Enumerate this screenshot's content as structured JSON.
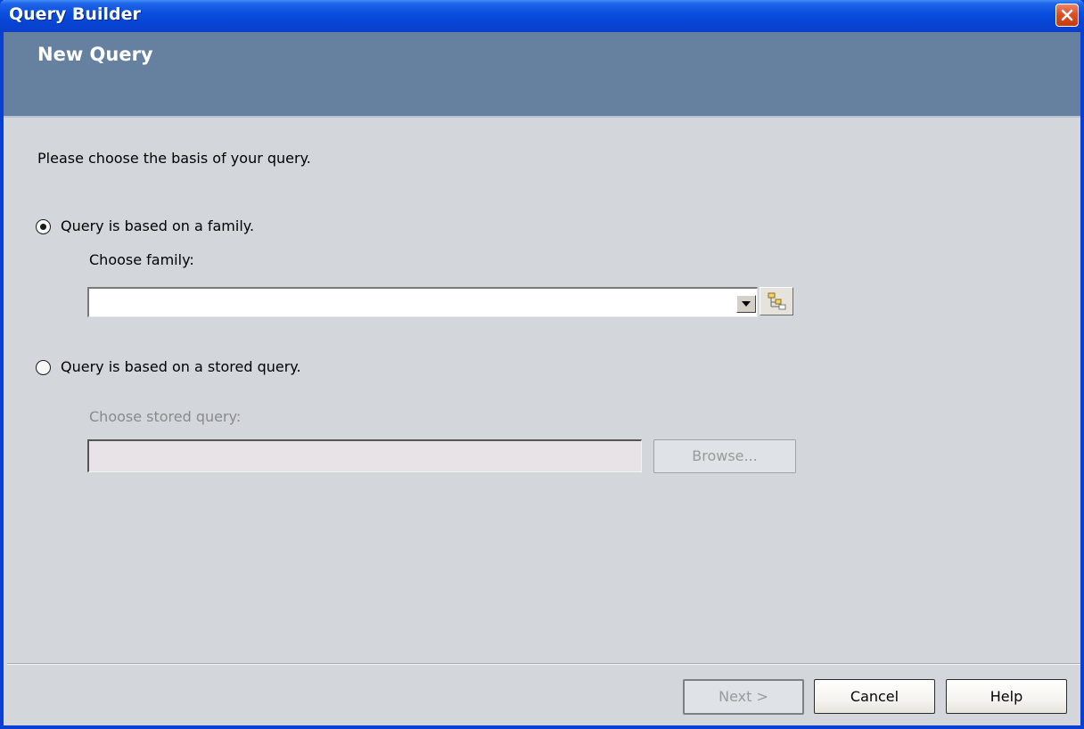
{
  "window": {
    "title": "Query Builder"
  },
  "header": {
    "title": "New Query"
  },
  "body": {
    "instruction": "Please choose the basis of your query.",
    "option_family": {
      "label": "Query is based on a family.",
      "selected": true,
      "choose_label": "Choose family:",
      "value": ""
    },
    "option_stored": {
      "label": "Query is based on a stored query.",
      "selected": false,
      "choose_label": "Choose stored query:",
      "value": "",
      "browse_label": "Browse..."
    }
  },
  "footer": {
    "next_label": "Next >",
    "cancel_label": "Cancel",
    "help_label": "Help"
  },
  "colors": {
    "titlebar": "#0a4fe0",
    "header_band": "#66819f",
    "dialog_background": "#d3d7dc",
    "close_button": "#dd4f26"
  },
  "icons": {
    "close": "close-icon",
    "dropdown": "chevron-down-icon",
    "tree": "family-tree-icon"
  }
}
